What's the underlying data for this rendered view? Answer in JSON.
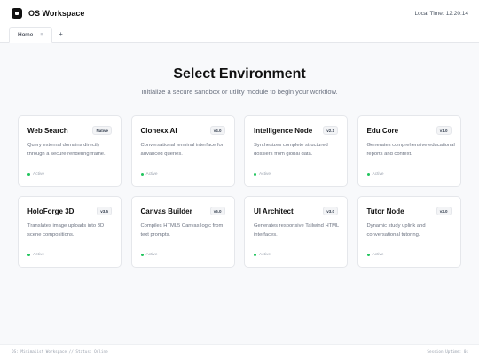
{
  "app": {
    "title": "OS Workspace"
  },
  "clock": {
    "label": "Local Time:",
    "value": "12:20:14"
  },
  "tabs": [
    {
      "label": "Home",
      "close": "≡"
    }
  ],
  "tab_add": "+",
  "main": {
    "title": "Select Environment",
    "subtitle": "Initialize a secure sandbox or utility module to begin your workflow."
  },
  "cards": [
    {
      "title": "Web Search",
      "badge": "Native",
      "desc": "Query external domains directly through a secure rendering frame.",
      "status": "Active"
    },
    {
      "title": "Clonexx AI",
      "badge": "v4.0",
      "desc": "Conversational terminal interface for advanced queries.",
      "status": "Active"
    },
    {
      "title": "Intelligence Node",
      "badge": "v2.1",
      "desc": "Synthesizes complete structured dossiers from global data.",
      "status": "Active"
    },
    {
      "title": "Edu Core",
      "badge": "v1.0",
      "desc": "Generates comprehensive educational reports and context.",
      "status": "Active"
    },
    {
      "title": "HoloForge 3D",
      "badge": "v3.5",
      "desc": "Translates image uploads into 3D scene compositions.",
      "status": "Active"
    },
    {
      "title": "Canvas Builder",
      "badge": "v6.0",
      "desc": "Compiles HTML5 Canvas logic from text prompts.",
      "status": "Active"
    },
    {
      "title": "UI Architect",
      "badge": "v3.0",
      "desc": "Generates responsive Tailwind HTML interfaces.",
      "status": "Active"
    },
    {
      "title": "Tutor Node",
      "badge": "v2.0",
      "desc": "Dynamic study uplink and conversational tutoring.",
      "status": "Active"
    }
  ],
  "footer": {
    "left": "OS: Minimalist Workspace // Status: Online",
    "right": "Session Uptime: 0s"
  },
  "colors": {
    "accent": "#111111",
    "status_active": "#22c55e",
    "background": "#f8f9fb"
  }
}
